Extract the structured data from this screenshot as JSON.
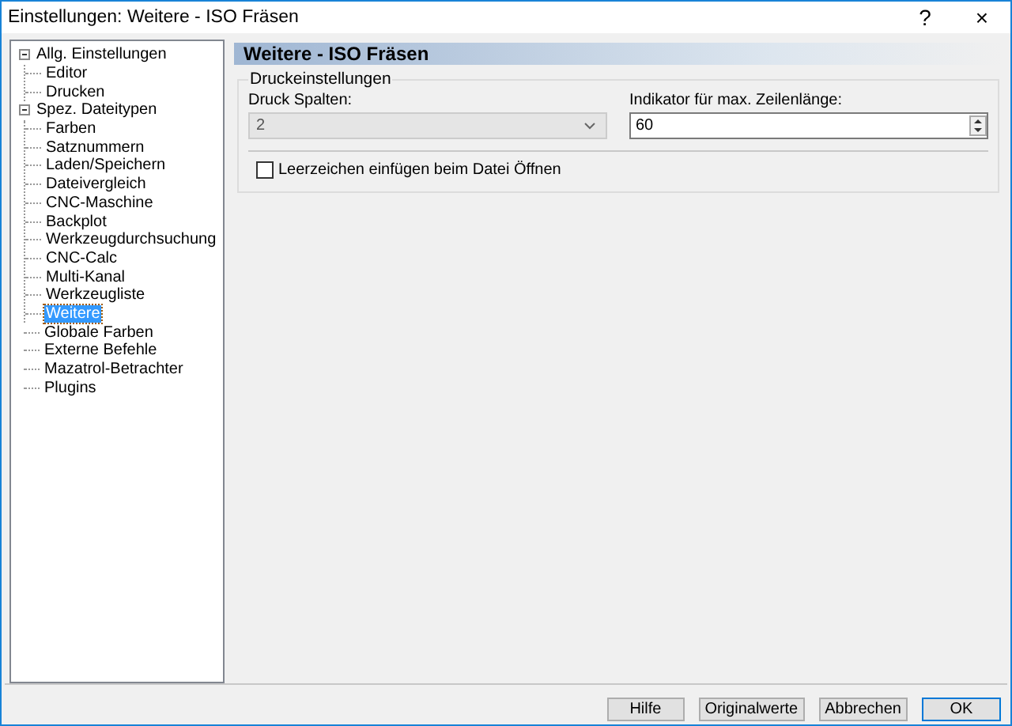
{
  "window": {
    "title": "Einstellungen: Weitere - ISO Fräsen",
    "help": "?",
    "close": "×"
  },
  "tree": [
    {
      "label": "Allg. Einstellungen",
      "selected": false,
      "expanded": true,
      "children": [
        {
          "label": "Editor",
          "selected": false
        },
        {
          "label": "Drucken",
          "selected": false
        }
      ]
    },
    {
      "label": "Spez. Dateitypen",
      "selected": false,
      "expanded": true,
      "children": [
        {
          "label": "Farben",
          "selected": false
        },
        {
          "label": "Satznummern",
          "selected": false
        },
        {
          "label": "Laden/Speichern",
          "selected": false
        },
        {
          "label": "Dateivergleich",
          "selected": false
        },
        {
          "label": "CNC-Maschine",
          "selected": false
        },
        {
          "label": "Backplot",
          "selected": false
        },
        {
          "label": "Werkzeugdurchsuchung",
          "selected": false
        },
        {
          "label": "CNC-Calc",
          "selected": false
        },
        {
          "label": "Multi-Kanal",
          "selected": false
        },
        {
          "label": "Werkzeugliste",
          "selected": false
        },
        {
          "label": "Weitere",
          "selected": true
        }
      ]
    },
    {
      "label": "Globale Farben",
      "selected": false
    },
    {
      "label": "Externe Befehle",
      "selected": false
    },
    {
      "label": "Mazatrol-Betrachter",
      "selected": false
    },
    {
      "label": "Plugins",
      "selected": false
    }
  ],
  "page": {
    "header": "Weitere - ISO Fräsen",
    "group": "Druckeinstellungen",
    "columns": {
      "label": "Druck Spalten:",
      "value": "2",
      "disabled": true
    },
    "indicator": {
      "label": "Indikator für max. Zeilenlänge:",
      "value": "60"
    },
    "spaces": {
      "label": "Leerzeichen einfügen beim Datei Öffnen",
      "checked": false
    }
  },
  "buttons": [
    {
      "label": "Hilfe",
      "default": false
    },
    {
      "label": "Originalwerte",
      "default": false
    },
    {
      "label": "Abbrechen",
      "default": false
    },
    {
      "label": "OK",
      "default": true
    }
  ]
}
